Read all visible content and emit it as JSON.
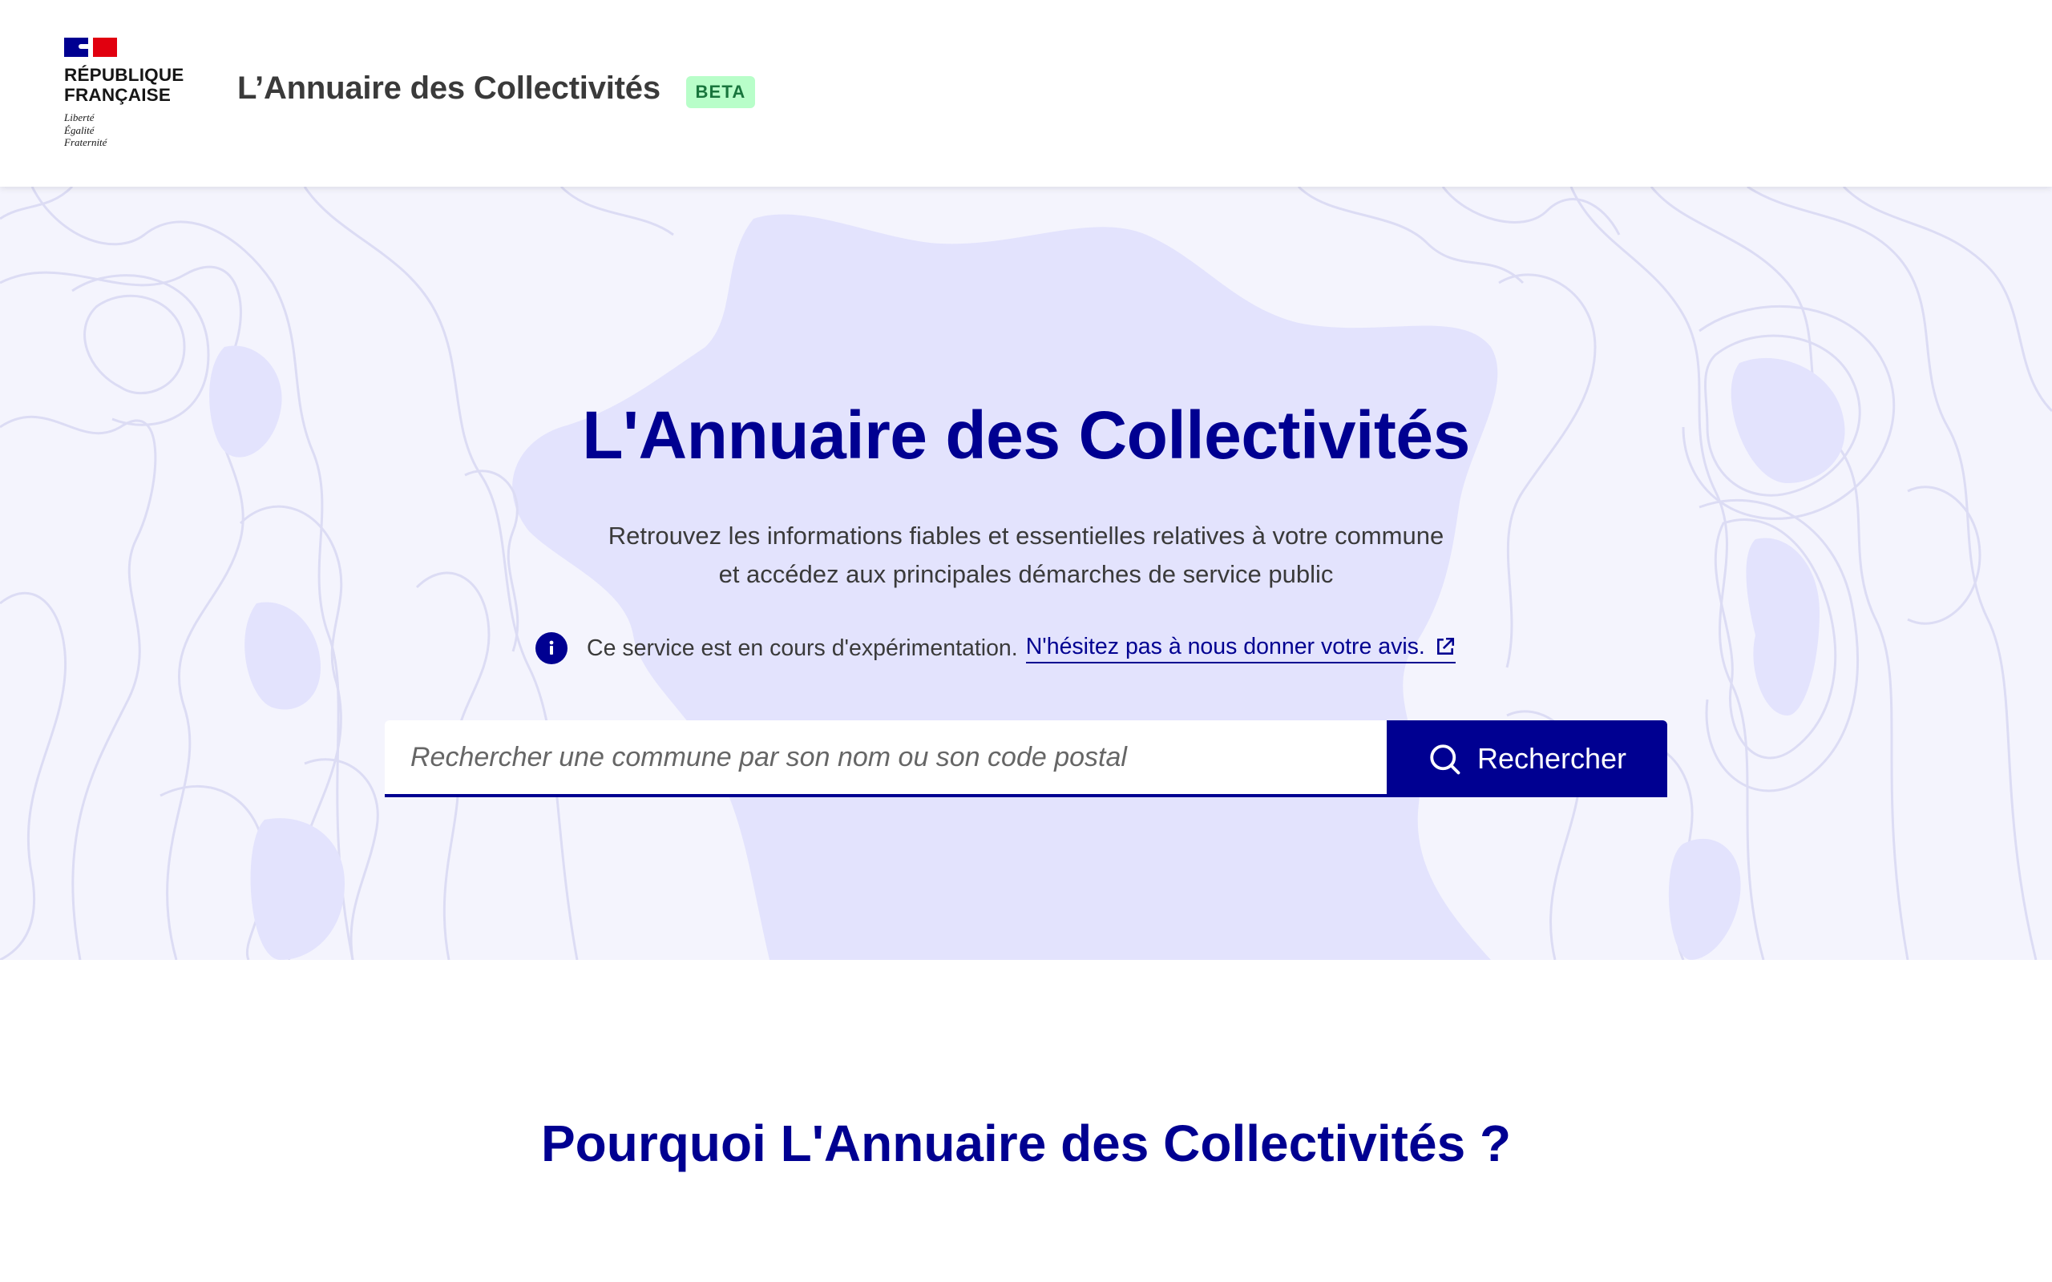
{
  "header": {
    "rf_name_line1": "RÉPUBLIQUE",
    "rf_name_line2": "FRANÇAISE",
    "rf_motto": [
      "Liberté",
      "Égalité",
      "Fraternité"
    ],
    "site_title": "L’Annuaire des Collectivités",
    "badge": "BETA"
  },
  "hero": {
    "title": "L'Annuaire des Collectivités",
    "description_line1": "Retrouvez les informations fiables et essentielles relatives à votre commune",
    "description_line2": "et accédez aux principales démarches de service public",
    "notice_text": "Ce service est en cours d'expérimentation.",
    "notice_link": "N'hésitez pas à nous donner votre avis.",
    "search": {
      "placeholder": "Rechercher une commune par son nom ou son code postal",
      "value": "",
      "button_label": "Rechercher"
    }
  },
  "why": {
    "title": "Pourquoi L'Annuaire des Collectivités ?"
  },
  "icons": {
    "info": "info-icon",
    "external_link": "external-link-icon",
    "search": "search-icon"
  },
  "colors": {
    "primary": "#000091",
    "hero_background": "#f4f4fd",
    "map_shape": "#e3e3fd",
    "badge_background": "#b8fec9",
    "badge_text": "#18753c",
    "marianne_red": "#e1000f"
  }
}
